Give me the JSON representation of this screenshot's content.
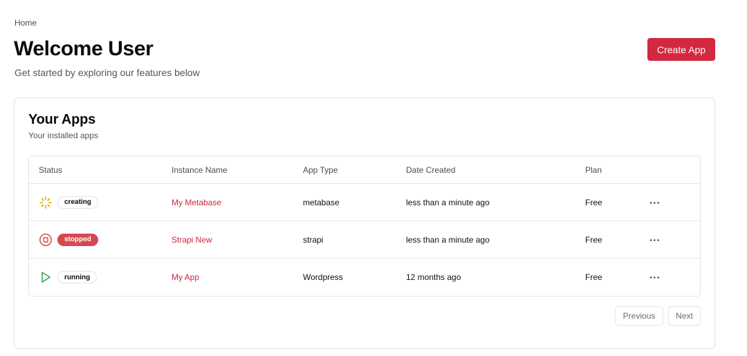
{
  "breadcrumb": {
    "home": "Home"
  },
  "header": {
    "title": "Welcome User",
    "subtitle": "Get started by exploring our features below",
    "create_button": "Create App"
  },
  "apps_card": {
    "title": "Your Apps",
    "subtitle": "Your installed apps",
    "columns": {
      "status": "Status",
      "name": "Instance Name",
      "type": "App Type",
      "date": "Date Created",
      "plan": "Plan"
    },
    "rows": [
      {
        "status": "creating",
        "status_icon": "loading-spinner-icon",
        "name": "My Metabase",
        "type": "metabase",
        "date": "less than a minute ago",
        "plan": "Free",
        "menu": "···"
      },
      {
        "status": "stopped",
        "status_icon": "stop-circle-icon",
        "name": "Strapi New",
        "type": "strapi",
        "date": "less than a minute ago",
        "plan": "Free",
        "menu": "···"
      },
      {
        "status": "running",
        "status_icon": "play-icon",
        "name": "My App",
        "type": "Wordpress",
        "date": "12 months ago",
        "plan": "Free",
        "menu": "···"
      }
    ],
    "pagination": {
      "previous": "Previous",
      "next": "Next"
    }
  },
  "colors": {
    "accent": "#d3283f",
    "link": "#c9283d",
    "creating": "#e0a800",
    "stopped": "#d8474f",
    "running": "#2ea44f"
  }
}
